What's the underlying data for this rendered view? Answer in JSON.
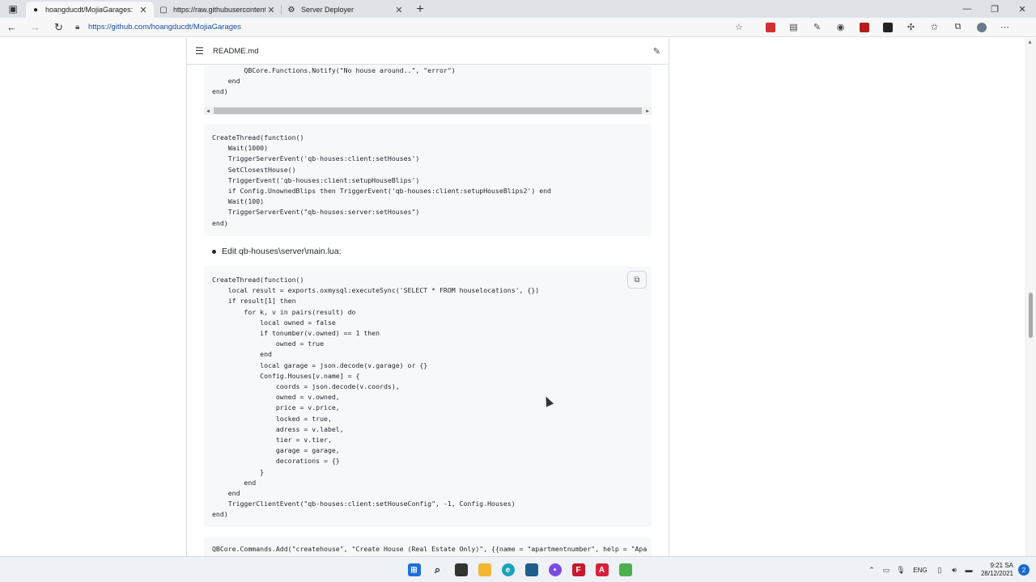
{
  "tabs": [
    {
      "title": "hoangducdt/MojiaGarages: ",
      "icon": "github-icon",
      "active": true
    },
    {
      "title": "https://raw.githubusercontent.cc",
      "icon": "page-icon",
      "active": false
    },
    {
      "title": "Server Deployer",
      "icon": "gear-icon",
      "active": false
    }
  ],
  "address": {
    "url": "https://github.com/hoangducdt/MojiaGarages"
  },
  "readme": {
    "filename": "README.md"
  },
  "code_block_1": {
    "text": "        QBCore.Functions.Notify(\"No house around..\", \"error\")\n    end\nend)"
  },
  "code_block_2": {
    "text": "CreateThread(function()\n    Wait(1000)\n    TriggerServerEvent('qb-houses:client:setHouses')\n    SetClosestHouse()\n    TriggerEvent('qb-houses:client:setupHouseBlips')\n    if Config.UnownedBlips then TriggerEvent('qb-houses:client:setupHouseBlips2') end\n    Wait(100)\n    TriggerServerEvent(\"qb-houses:server:setHouses\")\nend)"
  },
  "bullet": {
    "text": "Edit qb-houses\\server\\main.lua:"
  },
  "code_block_3": {
    "text": "CreateThread(function()\n    local result = exports.oxmysql:executeSync('SELECT * FROM houselocations', {})\n    if result[1] then\n        for k, v in pairs(result) do\n            local owned = false\n            if tonumber(v.owned) == 1 then\n                owned = true\n            end\n            local garage = json.decode(v.garage) or {}\n            Config.Houses[v.name] = {\n                coords = json.decode(v.coords),\n                owned = v.owned,\n                price = v.price,\n                locked = true,\n                adress = v.label,\n                tier = v.tier,\n                garage = garage,\n                decorations = {}\n            }\n        end\n    end\n    TriggerClientEvent(\"qb-houses:client:setHouseConfig\", -1, Config.Houses)\nend)"
  },
  "code_block_4": {
    "text": "QBCore.Commands.Add(\"createhouse\", \"Create House (Real Estate Only)\", {{name = \"apartmentnumber\", help = \"Apa"
  },
  "taskbar": {
    "lang": "ENG",
    "time": "9:21 SA",
    "date": "28/12/2021",
    "notifications": "2"
  }
}
